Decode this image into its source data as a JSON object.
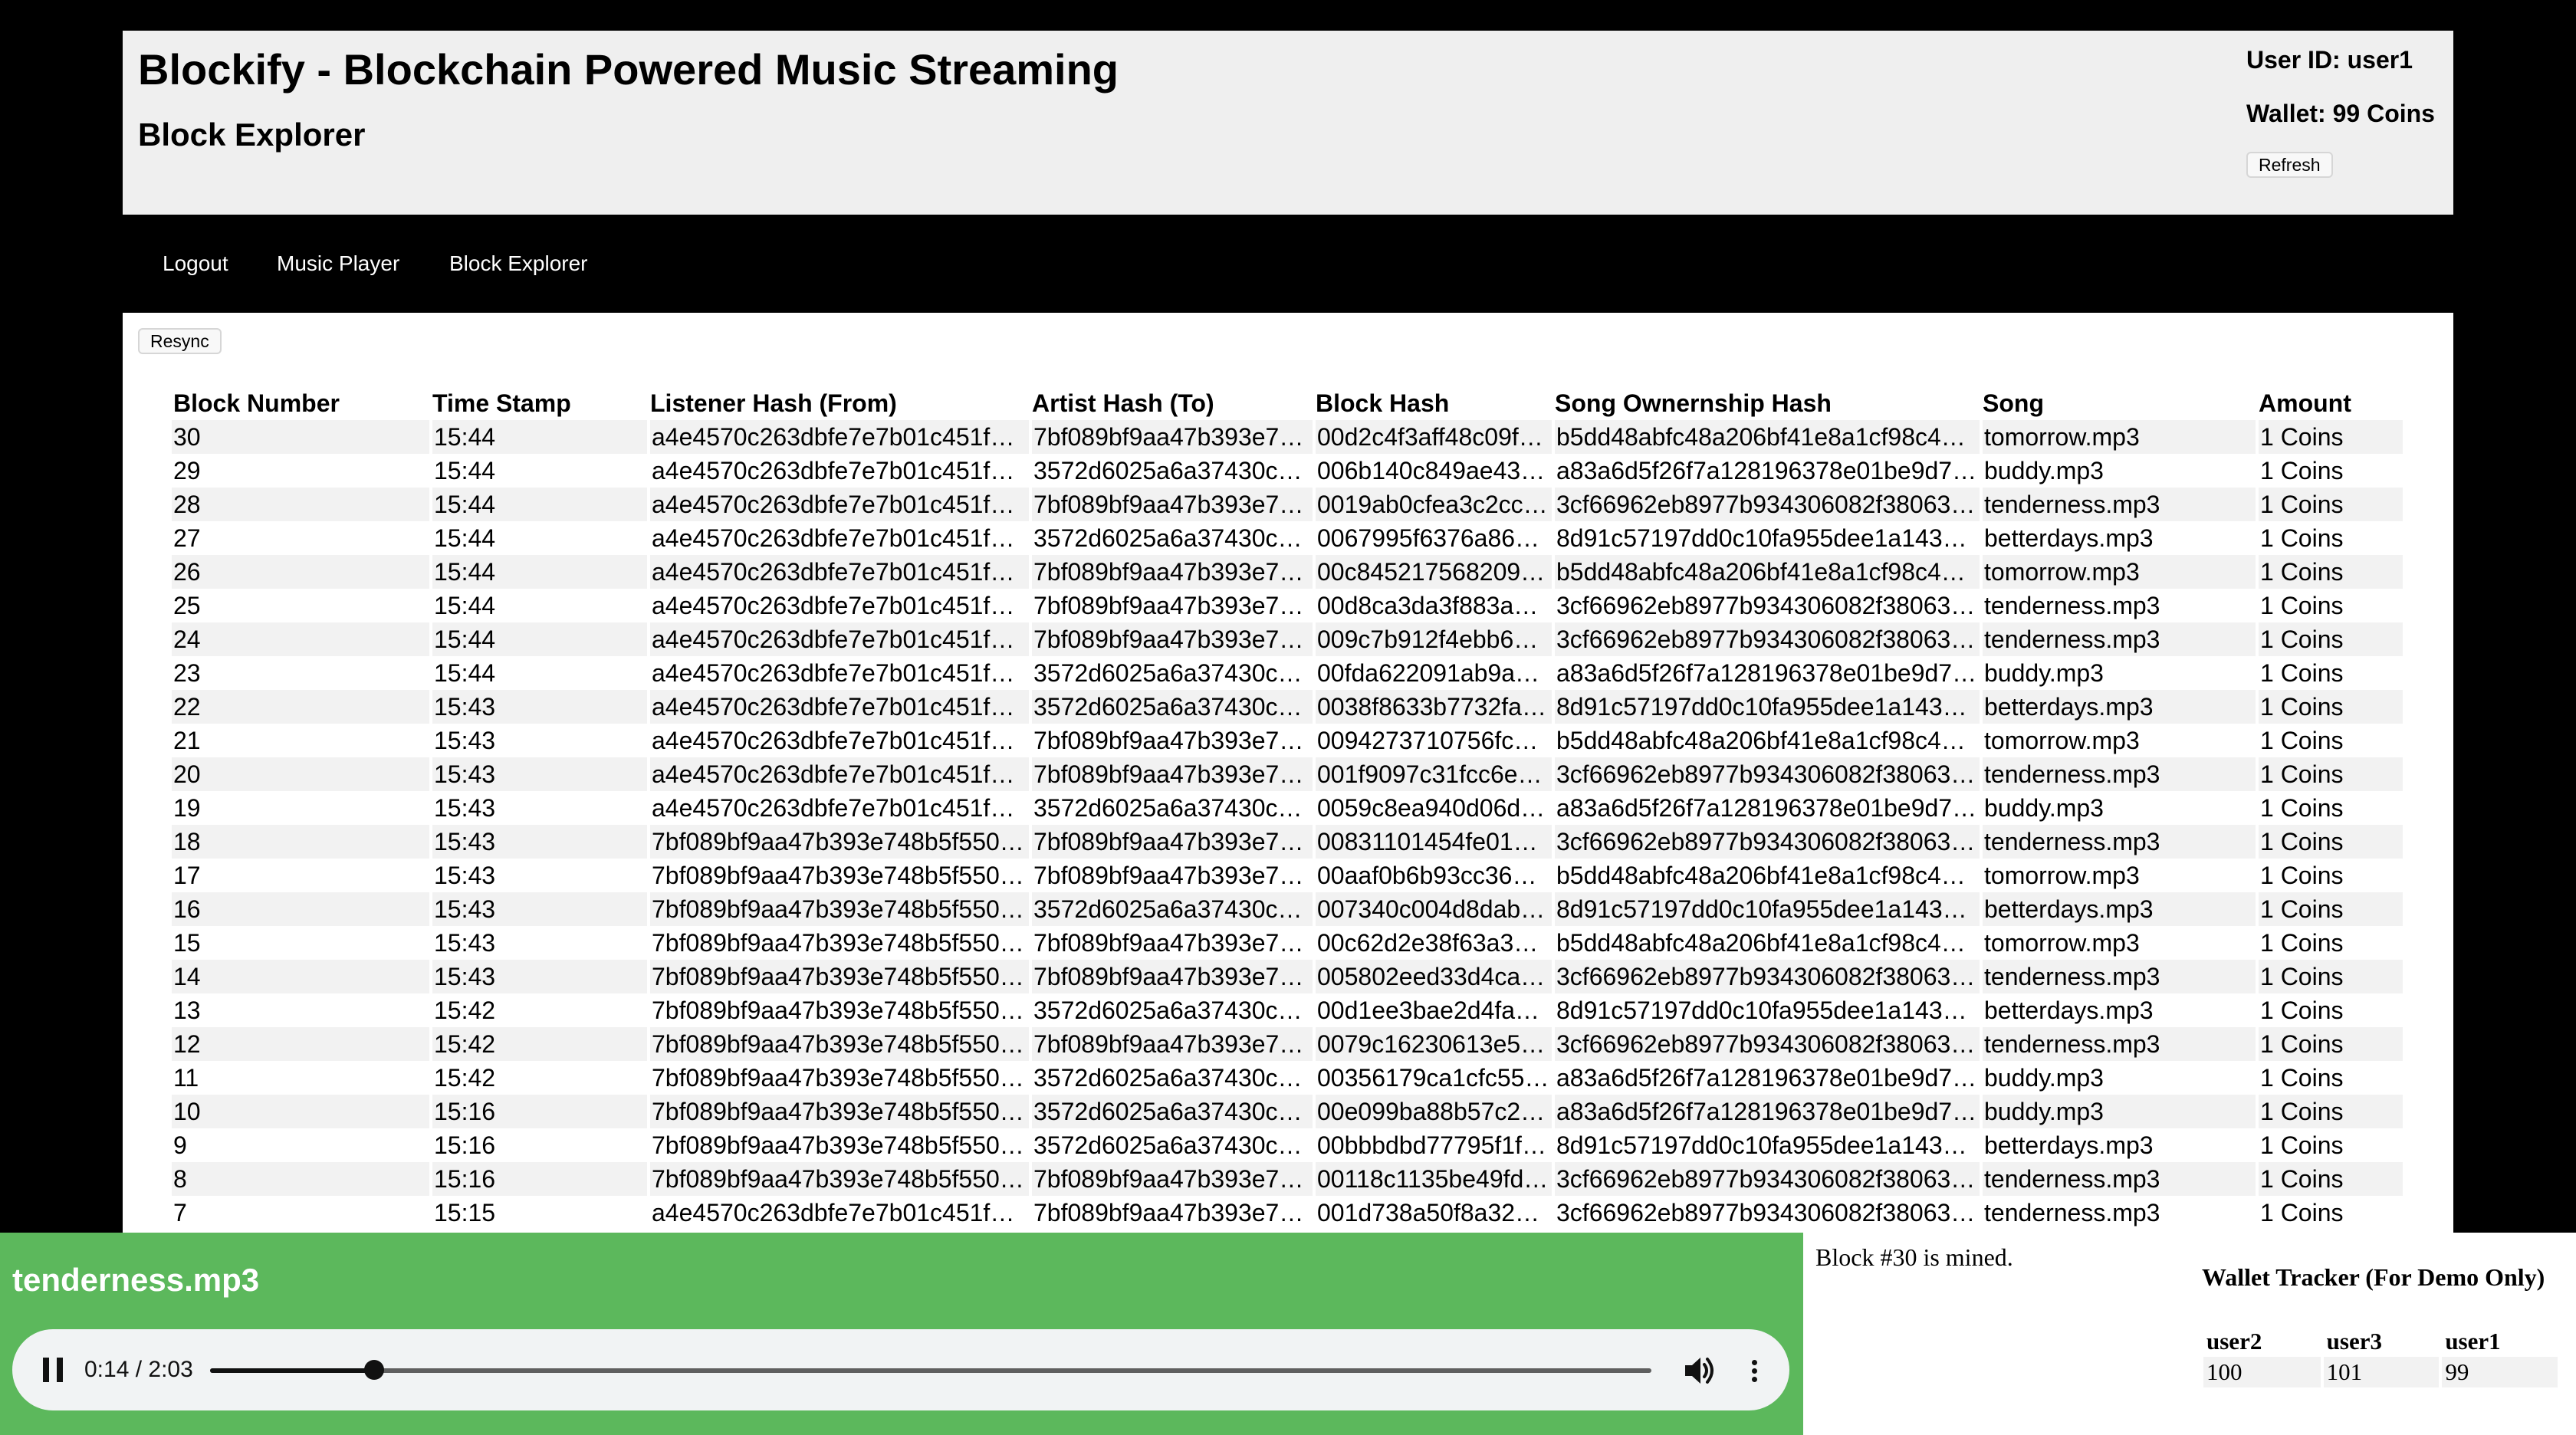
{
  "header": {
    "app_title": "Blockify - Blockchain Powered Music Streaming",
    "page_title": "Block Explorer",
    "user_id": "User ID: user1",
    "wallet": "Wallet: 99 Coins",
    "refresh_label": "Refresh"
  },
  "nav": {
    "logout": "Logout",
    "music_player": "Music Player",
    "block_explorer": "Block Explorer"
  },
  "explorer": {
    "resync_label": "Resync",
    "columns": [
      "Block Number",
      "Time Stamp",
      "Listener Hash (From)",
      "Artist Hash (To)",
      "Block Hash",
      "Song Ownernship Hash",
      "Song",
      "Amount"
    ],
    "rows": [
      [
        "30",
        "15:44",
        "a4e4570c263dbfe7e7b01c451f…",
        "7bf089bf9aa47b393e7…",
        "00d2c4f3aff48c09f…",
        "b5dd48abfc48a206bf41e8a1cf98c4…",
        "tomorrow.mp3",
        "1 Coins"
      ],
      [
        "29",
        "15:44",
        "a4e4570c263dbfe7e7b01c451f…",
        "3572d6025a6a37430c…",
        "006b140c849ae43…",
        "a83a6d5f26f7a128196378e01be9d7…",
        "buddy.mp3",
        "1 Coins"
      ],
      [
        "28",
        "15:44",
        "a4e4570c263dbfe7e7b01c451f…",
        "7bf089bf9aa47b393e7…",
        "0019ab0cfea3c2cc…",
        "3cf66962eb8977b934306082f38063…",
        "tenderness.mp3",
        "1 Coins"
      ],
      [
        "27",
        "15:44",
        "a4e4570c263dbfe7e7b01c451f…",
        "3572d6025a6a37430c…",
        "0067995f6376a86…",
        "8d91c57197dd0c10fa955dee1a143…",
        "betterdays.mp3",
        "1 Coins"
      ],
      [
        "26",
        "15:44",
        "a4e4570c263dbfe7e7b01c451f…",
        "7bf089bf9aa47b393e7…",
        "00c845217568209…",
        "b5dd48abfc48a206bf41e8a1cf98c4…",
        "tomorrow.mp3",
        "1 Coins"
      ],
      [
        "25",
        "15:44",
        "a4e4570c263dbfe7e7b01c451f…",
        "7bf089bf9aa47b393e7…",
        "00d8ca3da3f883a…",
        "3cf66962eb8977b934306082f38063…",
        "tenderness.mp3",
        "1 Coins"
      ],
      [
        "24",
        "15:44",
        "a4e4570c263dbfe7e7b01c451f…",
        "7bf089bf9aa47b393e7…",
        "009c7b912f4ebb6…",
        "3cf66962eb8977b934306082f38063…",
        "tenderness.mp3",
        "1 Coins"
      ],
      [
        "23",
        "15:44",
        "a4e4570c263dbfe7e7b01c451f…",
        "3572d6025a6a37430c…",
        "00fda622091ab9a…",
        "a83a6d5f26f7a128196378e01be9d7…",
        "buddy.mp3",
        "1 Coins"
      ],
      [
        "22",
        "15:43",
        "a4e4570c263dbfe7e7b01c451f…",
        "3572d6025a6a37430c…",
        "0038f8633b7732fa…",
        "8d91c57197dd0c10fa955dee1a143…",
        "betterdays.mp3",
        "1 Coins"
      ],
      [
        "21",
        "15:43",
        "a4e4570c263dbfe7e7b01c451f…",
        "7bf089bf9aa47b393e7…",
        "0094273710756fc…",
        "b5dd48abfc48a206bf41e8a1cf98c4…",
        "tomorrow.mp3",
        "1 Coins"
      ],
      [
        "20",
        "15:43",
        "a4e4570c263dbfe7e7b01c451f…",
        "7bf089bf9aa47b393e7…",
        "001f9097c31fcc6e…",
        "3cf66962eb8977b934306082f38063…",
        "tenderness.mp3",
        "1 Coins"
      ],
      [
        "19",
        "15:43",
        "a4e4570c263dbfe7e7b01c451f…",
        "3572d6025a6a37430c…",
        "0059c8ea940d06d…",
        "a83a6d5f26f7a128196378e01be9d7…",
        "buddy.mp3",
        "1 Coins"
      ],
      [
        "18",
        "15:43",
        "7bf089bf9aa47b393e748b5f550…",
        "7bf089bf9aa47b393e7…",
        "00831101454fe01…",
        "3cf66962eb8977b934306082f38063…",
        "tenderness.mp3",
        "1 Coins"
      ],
      [
        "17",
        "15:43",
        "7bf089bf9aa47b393e748b5f550…",
        "7bf089bf9aa47b393e7…",
        "00aaf0b6b93cc36…",
        "b5dd48abfc48a206bf41e8a1cf98c4…",
        "tomorrow.mp3",
        "1 Coins"
      ],
      [
        "16",
        "15:43",
        "7bf089bf9aa47b393e748b5f550…",
        "3572d6025a6a37430c…",
        "007340c004d8dab…",
        "8d91c57197dd0c10fa955dee1a143…",
        "betterdays.mp3",
        "1 Coins"
      ],
      [
        "15",
        "15:43",
        "7bf089bf9aa47b393e748b5f550…",
        "7bf089bf9aa47b393e7…",
        "00c62d2e38f63a3…",
        "b5dd48abfc48a206bf41e8a1cf98c4…",
        "tomorrow.mp3",
        "1 Coins"
      ],
      [
        "14",
        "15:43",
        "7bf089bf9aa47b393e748b5f550…",
        "7bf089bf9aa47b393e7…",
        "005802eed33d4ca…",
        "3cf66962eb8977b934306082f38063…",
        "tenderness.mp3",
        "1 Coins"
      ],
      [
        "13",
        "15:42",
        "7bf089bf9aa47b393e748b5f550…",
        "3572d6025a6a37430c…",
        "00d1ee3bae2d4fa…",
        "8d91c57197dd0c10fa955dee1a143…",
        "betterdays.mp3",
        "1 Coins"
      ],
      [
        "12",
        "15:42",
        "7bf089bf9aa47b393e748b5f550…",
        "7bf089bf9aa47b393e7…",
        "0079c16230613e5…",
        "3cf66962eb8977b934306082f38063…",
        "tenderness.mp3",
        "1 Coins"
      ],
      [
        "11",
        "15:42",
        "7bf089bf9aa47b393e748b5f550…",
        "3572d6025a6a37430c…",
        "00356179ca1cfc55…",
        "a83a6d5f26f7a128196378e01be9d7…",
        "buddy.mp3",
        "1 Coins"
      ],
      [
        "10",
        "15:16",
        "7bf089bf9aa47b393e748b5f550…",
        "3572d6025a6a37430c…",
        "00e099ba88b57c2…",
        "a83a6d5f26f7a128196378e01be9d7…",
        "buddy.mp3",
        "1 Coins"
      ],
      [
        "9",
        "15:16",
        "7bf089bf9aa47b393e748b5f550…",
        "3572d6025a6a37430c…",
        "00bbbdbd77795f1f…",
        "8d91c57197dd0c10fa955dee1a143…",
        "betterdays.mp3",
        "1 Coins"
      ],
      [
        "8",
        "15:16",
        "7bf089bf9aa47b393e748b5f550…",
        "7bf089bf9aa47b393e7…",
        "00118c1135be49fd…",
        "3cf66962eb8977b934306082f38063…",
        "tenderness.mp3",
        "1 Coins"
      ],
      [
        "7",
        "15:15",
        "a4e4570c263dbfe7e7b01c451f…",
        "7bf089bf9aa47b393e7…",
        "001d738a50f8a32…",
        "3cf66962eb8977b934306082f38063…",
        "tenderness.mp3",
        "1 Coins"
      ]
    ]
  },
  "player": {
    "now_playing": "tenderness.mp3",
    "time": "0:14 / 2:03",
    "progress_fraction": 0.1138,
    "icons": {
      "play_state": "pause-icon",
      "volume": "volume-icon",
      "menu": "more-vertical-icon"
    }
  },
  "status": {
    "mined_message": "Block #30 is mined."
  },
  "wallet_tracker": {
    "title": "Wallet Tracker (For Demo Only)",
    "headers": [
      "user2",
      "user3",
      "user1"
    ],
    "values": [
      "100",
      "101",
      "99"
    ]
  },
  "colors": {
    "page_background": "#000000",
    "player_green": "#5cb85c",
    "row_stripe": "#f2f2f2"
  }
}
